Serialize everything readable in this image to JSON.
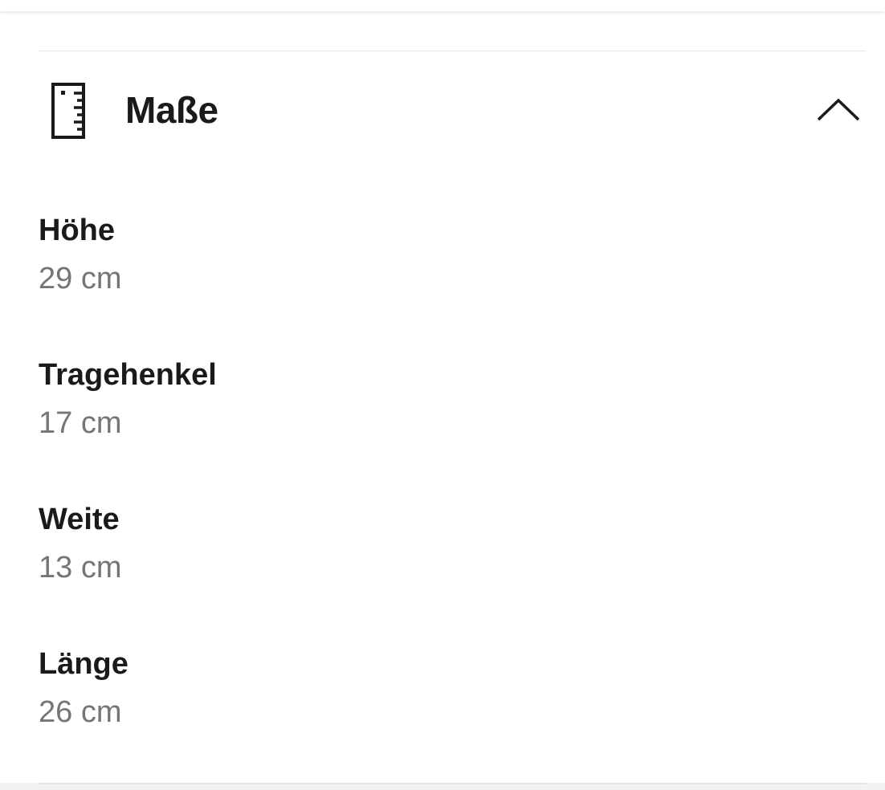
{
  "section": {
    "title": "Maße",
    "icon": "ruler-icon",
    "toggle_icon": "chevron-up-icon",
    "expanded": true
  },
  "specs": [
    {
      "label": "Höhe",
      "value": "29 cm"
    },
    {
      "label": "Tragehenkel",
      "value": "17 cm"
    },
    {
      "label": "Weite",
      "value": "13 cm"
    },
    {
      "label": "Länge",
      "value": "26 cm"
    }
  ],
  "colors": {
    "label": "#1a1a1a",
    "value": "#757575",
    "divider": "#e6e6e6"
  }
}
